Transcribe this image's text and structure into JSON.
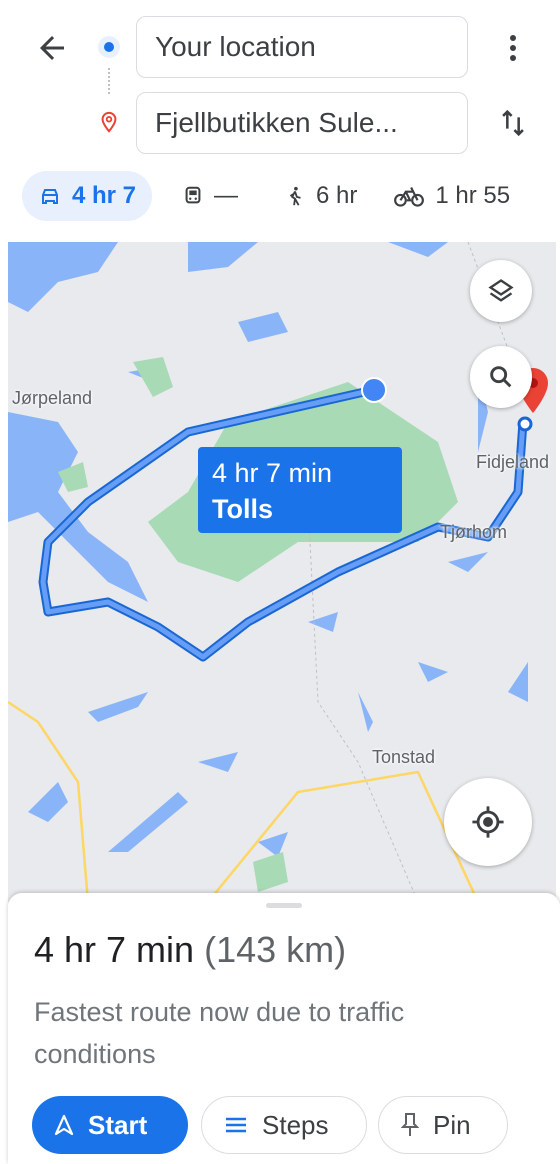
{
  "search": {
    "origin": "Your location",
    "destination": "Fjellbutikken Sule..."
  },
  "modes": [
    {
      "icon": "car-icon",
      "label": "4 hr 7",
      "active": true
    },
    {
      "icon": "transit-icon",
      "label": "—",
      "active": false
    },
    {
      "icon": "walk-icon",
      "label": "6 hr",
      "active": false
    },
    {
      "icon": "bike-icon",
      "label": "1 hr 55",
      "active": false
    }
  ],
  "map": {
    "places": [
      "Jørpeland",
      "Fidjeland",
      "Tjørhom",
      "Tonstad"
    ],
    "route_label": {
      "time": "4 hr 7 min",
      "tolls": "Tolls"
    },
    "colors": {
      "route": "#4285f4",
      "water": "#8ab4f8",
      "park": "#a8dab5",
      "land": "#e8eaed"
    }
  },
  "sheet": {
    "duration": "4 hr 7 min",
    "distance": "(143 km)",
    "note": "Fastest route now due to traffic conditions",
    "buttons": {
      "start": "Start",
      "steps": "Steps",
      "pin": "Pin"
    }
  },
  "accent": "#1a73e8"
}
